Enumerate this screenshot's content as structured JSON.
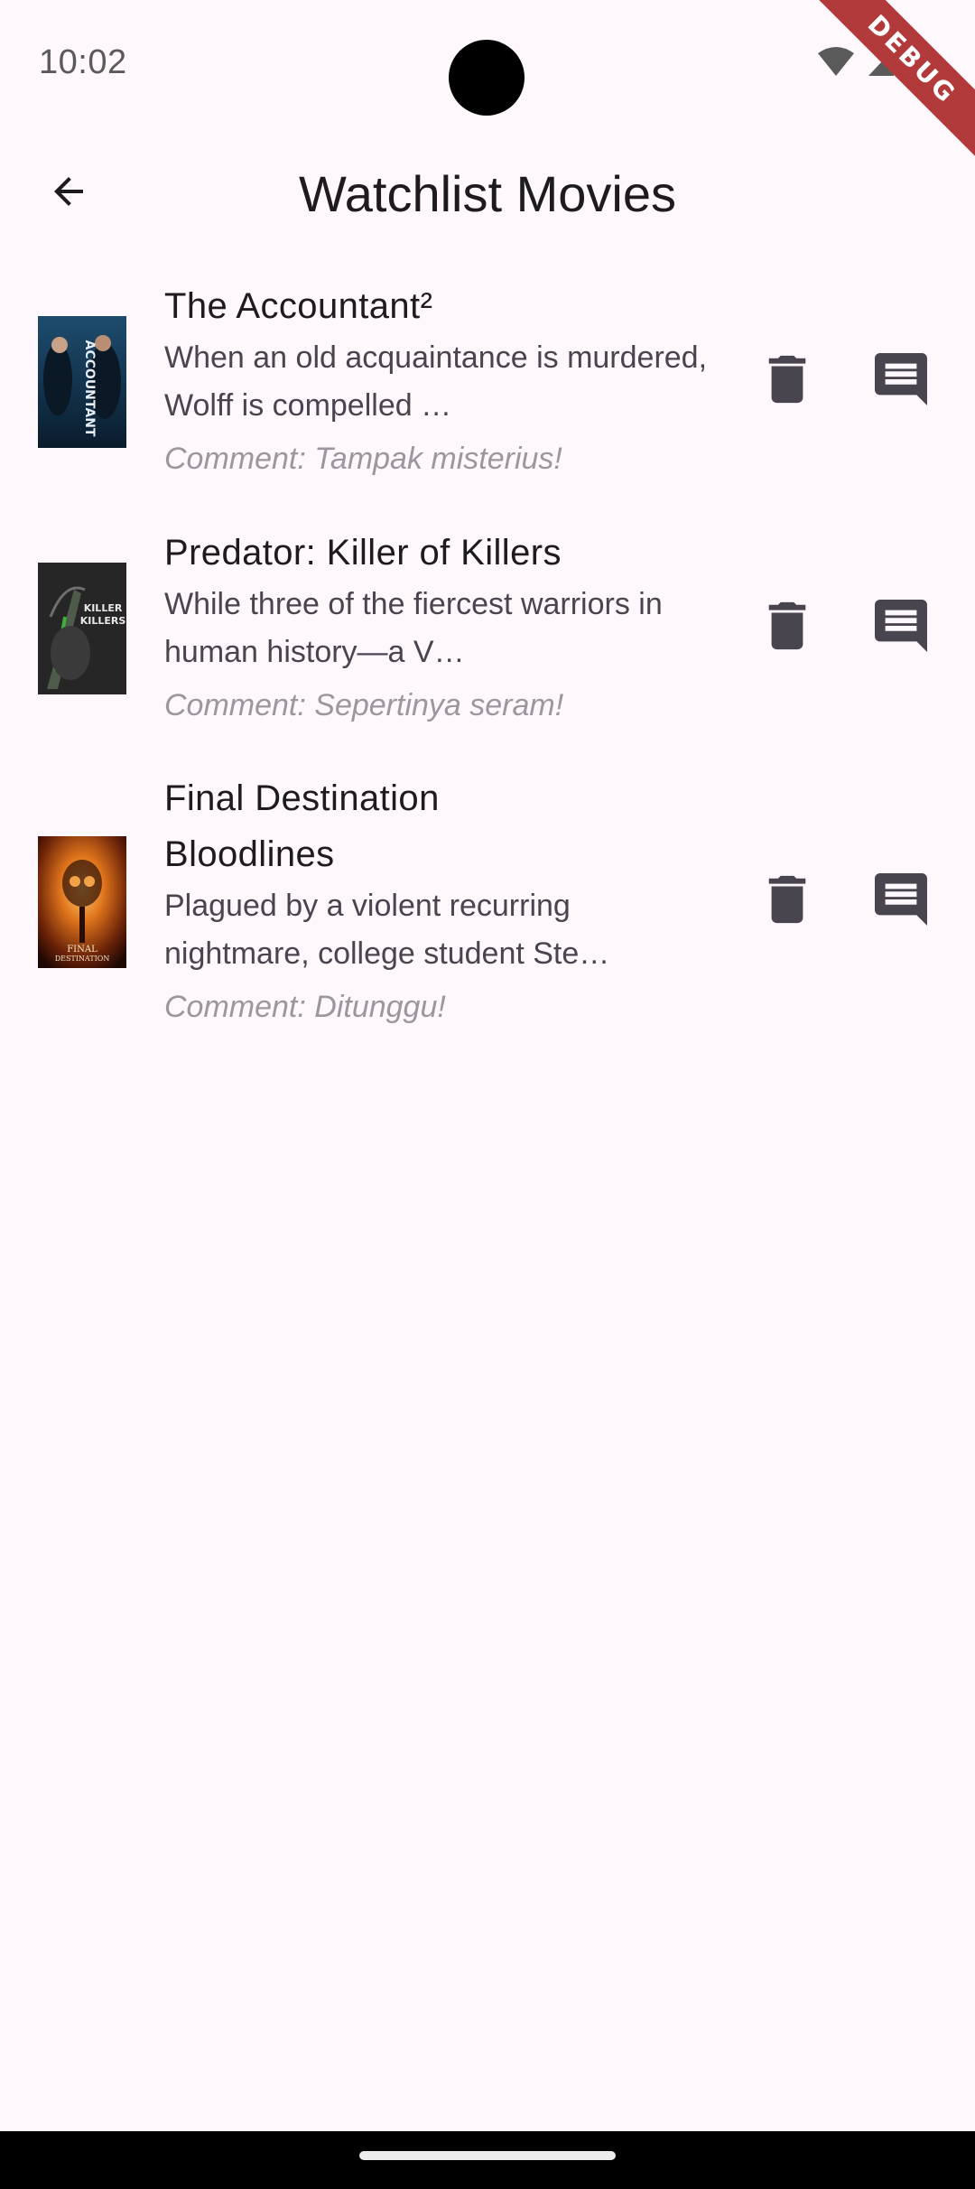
{
  "status_bar": {
    "time": "10:02"
  },
  "debug_banner": {
    "label": "DEBUG",
    "color": "#b23a3a"
  },
  "app_bar": {
    "title": "Watchlist Movies",
    "back_icon": "arrow-back-icon"
  },
  "movies": [
    {
      "title": "The Accountant²",
      "overview": "When an old acquaintance is murdered, Wolff is compelled …",
      "comment": "Comment: Tampak misterius!",
      "poster_text": "ACCOUNTANT",
      "delete_icon": "trash-icon",
      "comment_icon": "comment-icon"
    },
    {
      "title": "Predator: Killer of Killers",
      "overview": "While three of the fiercest warriors in human history—a V…",
      "comment": "Comment: Sepertinya seram!",
      "poster_text": "KILLER KILLERS",
      "delete_icon": "trash-icon",
      "comment_icon": "comment-icon"
    },
    {
      "title": "Final Destination Bloodlines",
      "overview": "Plagued by a violent recurring nightmare, college student Ste…",
      "comment": "Comment: Ditunggu!",
      "poster_text": "FINAL DESTINATION",
      "delete_icon": "trash-icon",
      "comment_icon": "comment-icon"
    }
  ],
  "colors": {
    "background": "#fef7fc",
    "title_text": "#1d1b20",
    "body_text": "#49454f",
    "comment_text": "#9a979e",
    "icon": "#49454f"
  }
}
